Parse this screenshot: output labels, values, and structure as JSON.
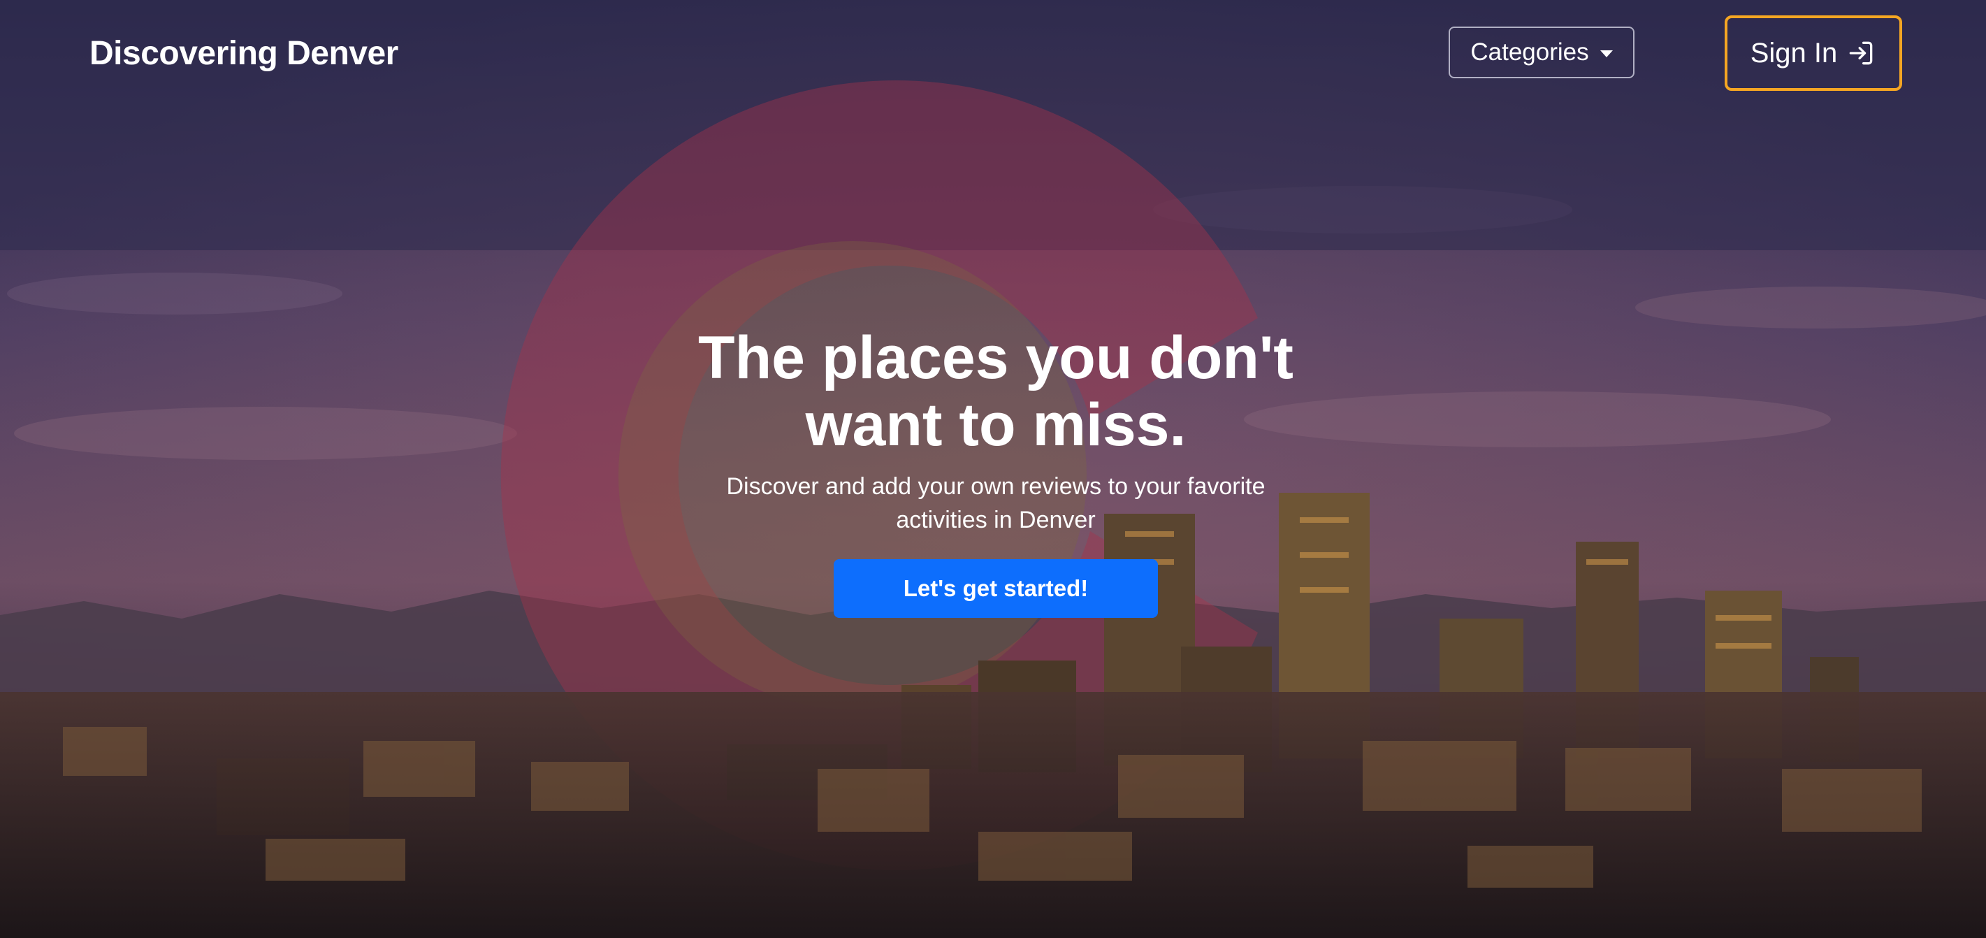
{
  "navbar": {
    "brand": "Discovering Denver",
    "categories_label": "Categories",
    "signin_label": "Sign In"
  },
  "hero": {
    "title": "The places you don't want to miss.",
    "subtitle": "Discover and add your own reviews to your favorite activities in Denver",
    "cta_label": "Let's get started!"
  },
  "colors": {
    "cta": "#0d6efd",
    "signin_border": "#f5a623",
    "overlay": "#2b2a4c"
  },
  "icons": {
    "categories": "caret-down-icon",
    "signin": "sign-in-arrow-icon"
  }
}
